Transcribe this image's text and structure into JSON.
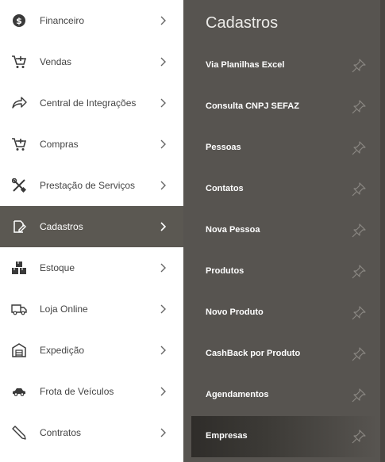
{
  "sidebar": {
    "items": [
      {
        "label": "Financeiro",
        "icon": "dollar-circle-icon"
      },
      {
        "label": "Vendas",
        "icon": "cart-plus-icon"
      },
      {
        "label": "Central de Integrações",
        "icon": "share-arrow-icon"
      },
      {
        "label": "Compras",
        "icon": "cart-plus-icon"
      },
      {
        "label": "Prestação de Serviços",
        "icon": "tools-icon"
      },
      {
        "label": "Cadastros",
        "icon": "edit-document-icon",
        "active": true
      },
      {
        "label": "Estoque",
        "icon": "boxes-icon"
      },
      {
        "label": "Loja Online",
        "icon": "delivery-truck-icon"
      },
      {
        "label": "Expedição",
        "icon": "warehouse-icon"
      },
      {
        "label": "Frota de Veículos",
        "icon": "car-icon"
      },
      {
        "label": "Contratos",
        "icon": "pen-icon"
      }
    ]
  },
  "submenu": {
    "title": "Cadastros",
    "items": [
      {
        "label": "Via Planilhas Excel"
      },
      {
        "label": "Consulta CNPJ SEFAZ"
      },
      {
        "label": "Pessoas"
      },
      {
        "label": "Contatos"
      },
      {
        "label": "Nova Pessoa"
      },
      {
        "label": "Produtos"
      },
      {
        "label": "Novo Produto"
      },
      {
        "label": "CashBack por Produto"
      },
      {
        "label": "Agendamentos"
      },
      {
        "label": "Empresas",
        "highlighted": true
      }
    ]
  },
  "colors": {
    "sidebar_bg": "#ffffff",
    "active_bg": "#5b5852",
    "submenu_bg": "#575450",
    "text_dark": "#444444",
    "text_light": "#ffffff"
  }
}
